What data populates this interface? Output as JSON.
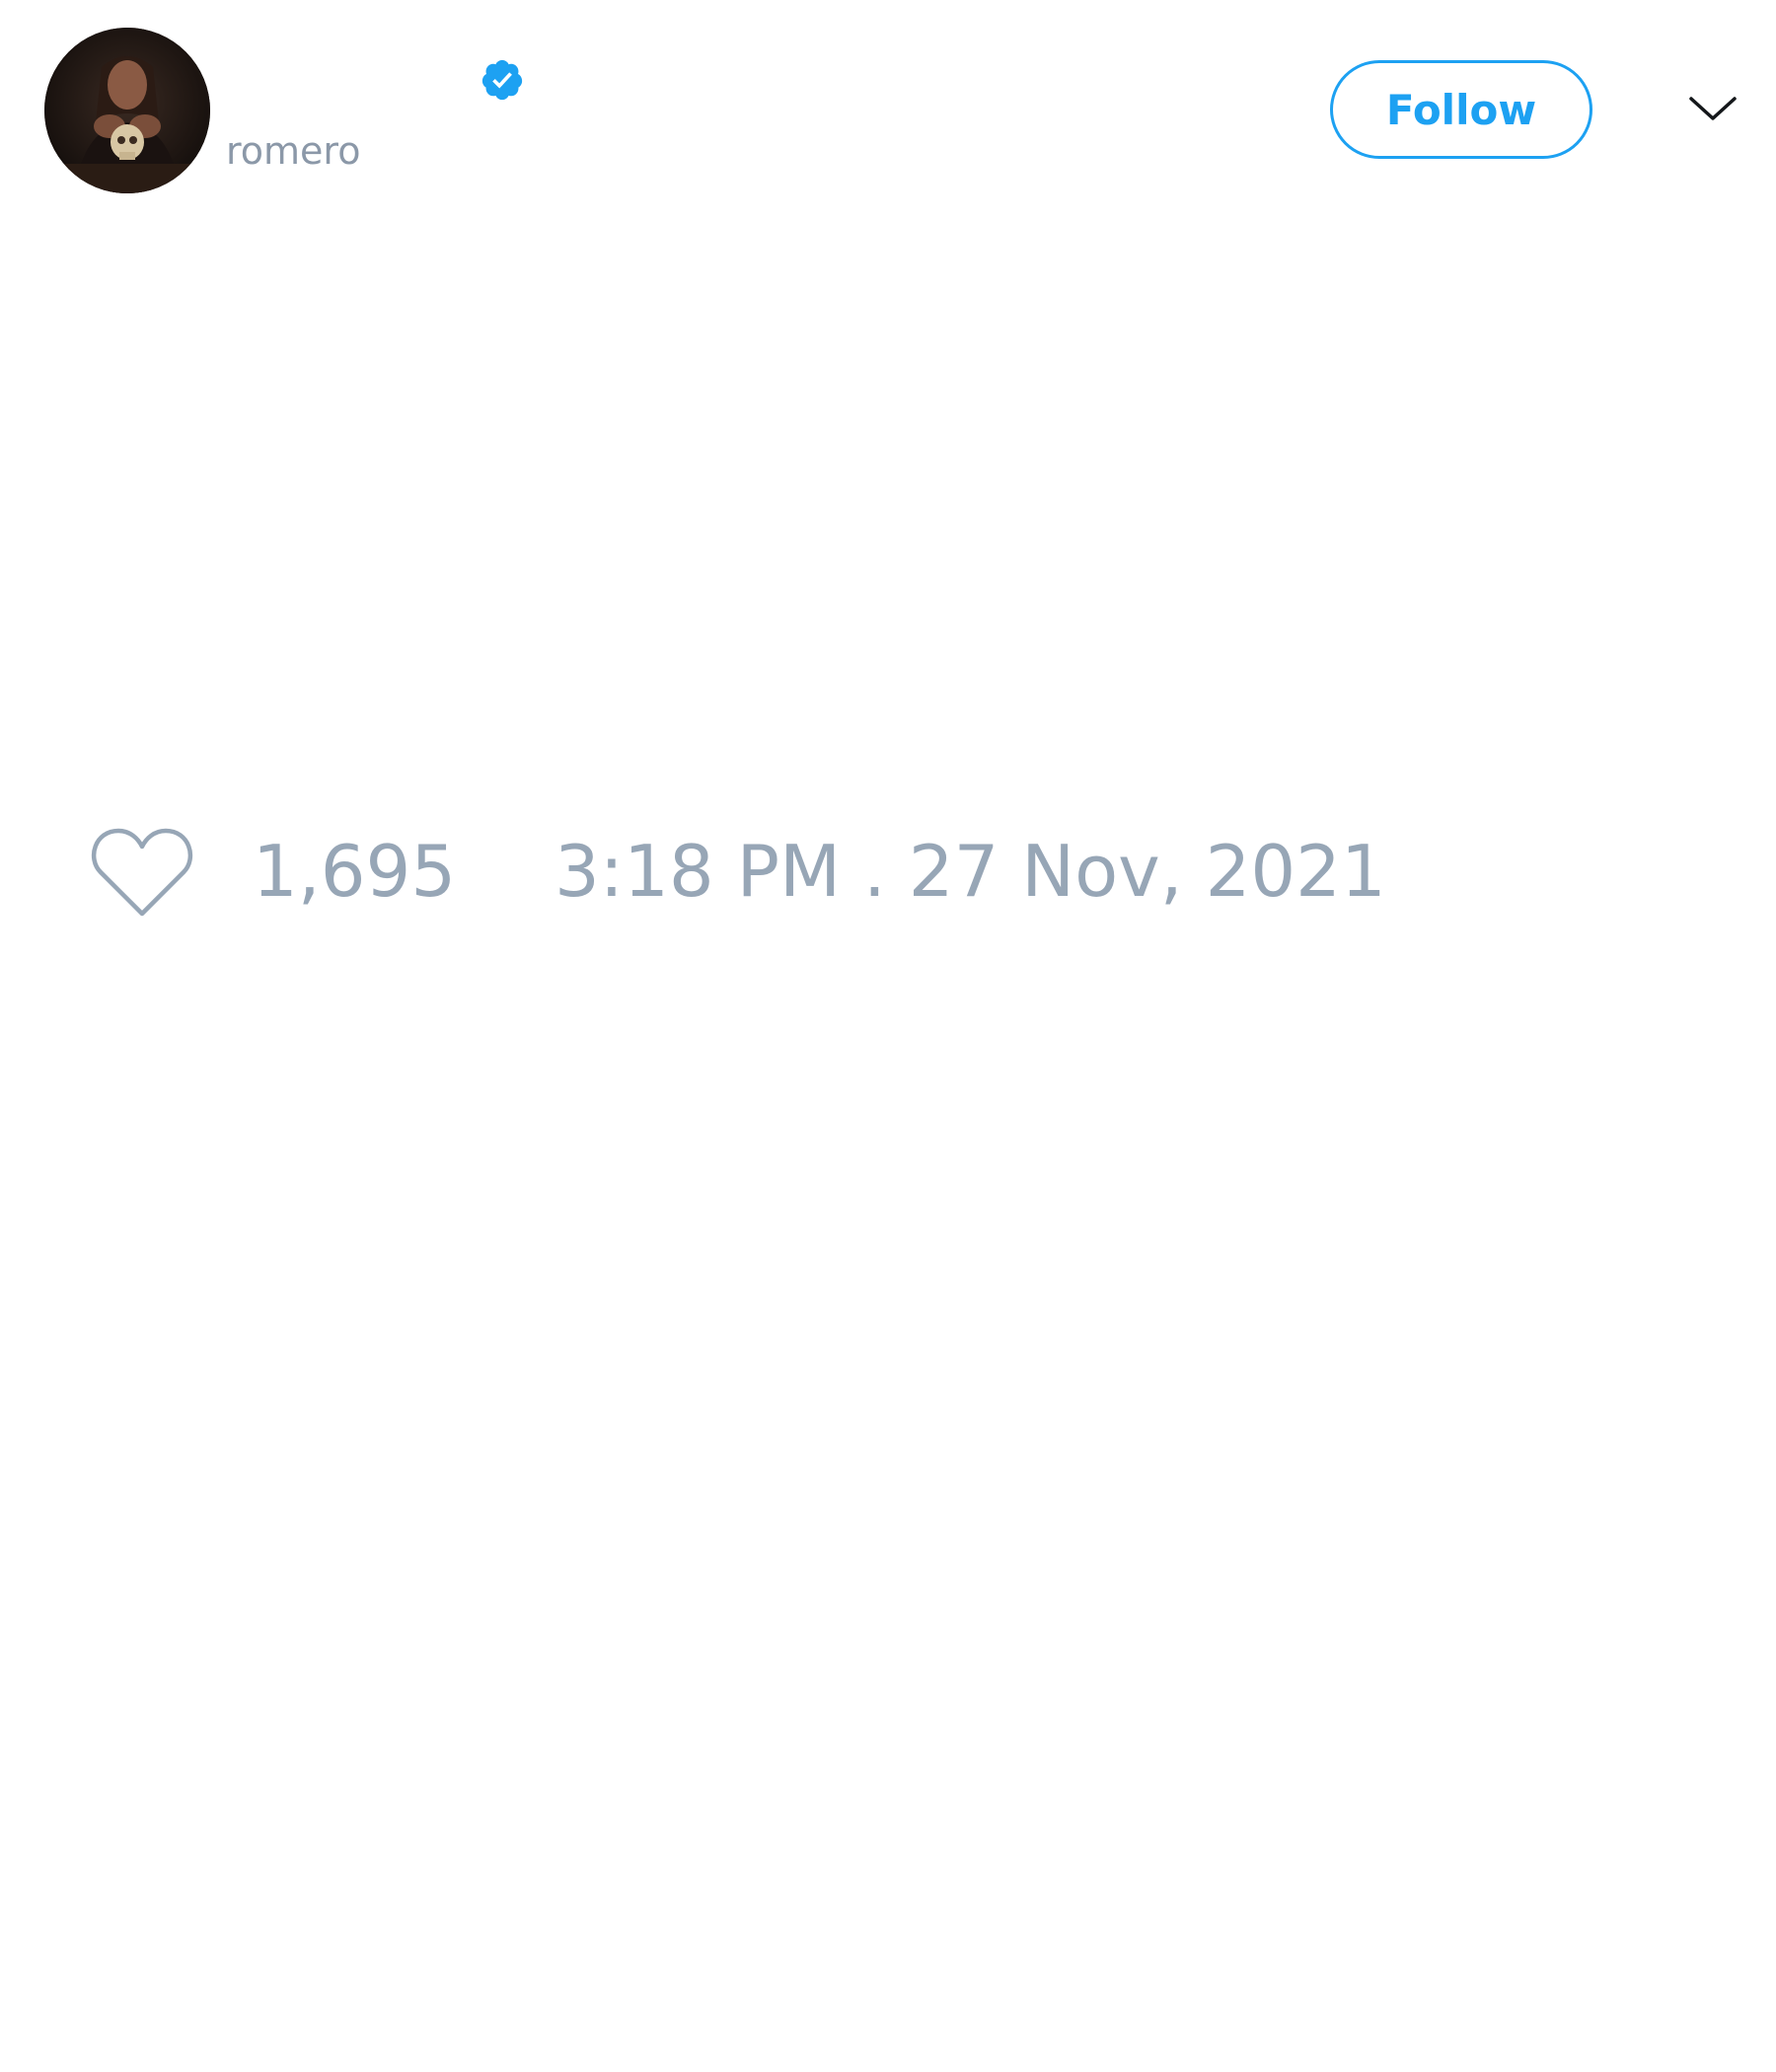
{
  "tweet": {
    "author": {
      "display_name": "",
      "username": "romero",
      "verified": true,
      "avatar_icon": "avatar-photo"
    },
    "follow_label": "Follow",
    "menu_icon": "chevron-down-icon",
    "likes": {
      "icon": "heart-icon",
      "count": "1,695"
    },
    "timestamp": "3:18 PM . 27 Nov, 2021"
  },
  "colors": {
    "accent": "#1da1f2",
    "muted_text": "#97a6b6",
    "username_text": "#8b98a8",
    "background": "#ffffff"
  }
}
